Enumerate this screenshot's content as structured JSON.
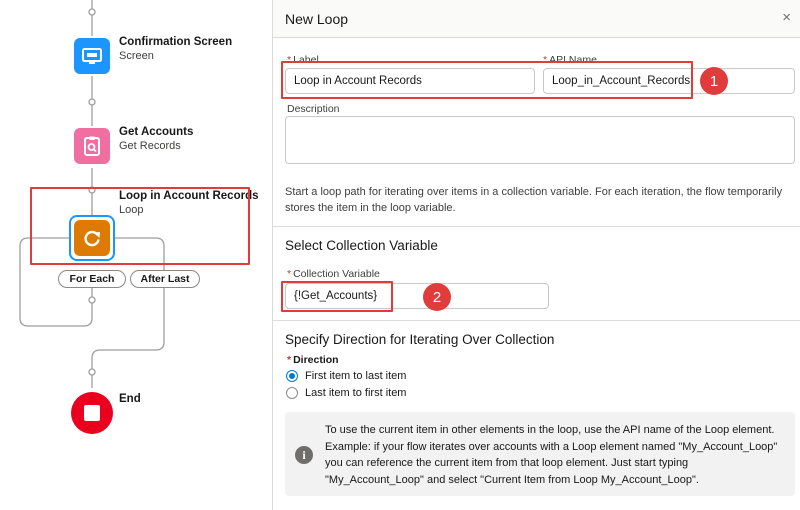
{
  "canvas": {
    "nodes": [
      {
        "title": "Confirmation Screen",
        "subtitle": "Screen",
        "icon": "screen-icon",
        "color": "#1b96ff"
      },
      {
        "title": "Get Accounts",
        "subtitle": "Get Records",
        "icon": "clipboard-search-icon",
        "color": "#f06ea0"
      },
      {
        "title": "Loop in Account Records",
        "subtitle": "Loop",
        "icon": "loop-icon",
        "color": "#dd7a01"
      },
      {
        "title": "End",
        "subtitle": "",
        "icon": "stop-icon",
        "color": "#ea001e"
      }
    ],
    "paths": {
      "for_each": "For Each",
      "after_last": "After Last"
    }
  },
  "panel": {
    "title": "New Loop",
    "close_glyph": "×",
    "label_field": {
      "label": "Label",
      "value": "Loop in Account Records",
      "required": "*"
    },
    "api_field": {
      "label": "API Name",
      "value": "Loop_in_Account_Records",
      "required": "*"
    },
    "description": {
      "label": "Description",
      "value": ""
    },
    "help_text": "Start a loop path for iterating over items in a collection variable. For each iteration, the flow temporarily stores the item in the loop variable.",
    "collection_section": {
      "title": "Select Collection Variable",
      "field_label": "Collection Variable",
      "required": "*",
      "value": "{!Get_Accounts}"
    },
    "direction_section": {
      "title": "Specify Direction for Iterating Over Collection",
      "label": "Direction",
      "required": "*",
      "options": [
        {
          "label": "First item to last item",
          "checked": true
        },
        {
          "label": "Last item to first item",
          "checked": false
        }
      ]
    },
    "info": {
      "icon_glyph": "i",
      "text": "To use the current item in other elements in the loop, use the API name of the Loop element. Example: if your flow iterates over accounts with a Loop element named \"My_Account_Loop\" you can reference the current item from that loop element. Just start typing \"My_Account_Loop\" and select \"Current Item from Loop My_Account_Loop\"."
    }
  },
  "annotations": {
    "badge_1": "1",
    "badge_2": "2",
    "highlight_color": "#e03c3c"
  }
}
